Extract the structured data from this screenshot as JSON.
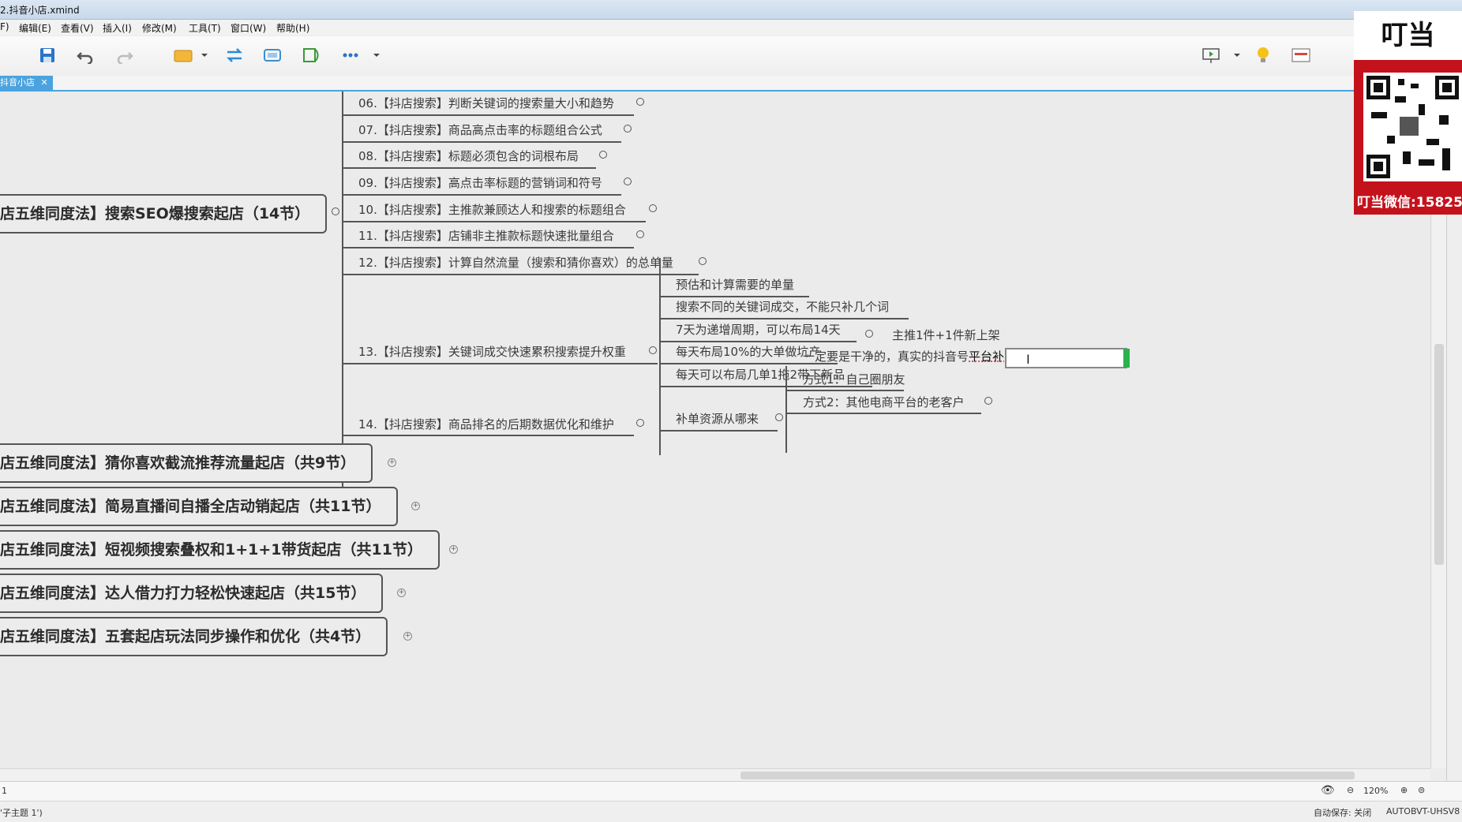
{
  "window": {
    "title": "2.抖音小店.xmind"
  },
  "menu": [
    "F)",
    "编辑(E)",
    "查看(V)",
    "插入(I)",
    "修改(M)",
    "工具(T)",
    "窗口(W)",
    "帮助(H)"
  ],
  "tab": {
    "label": "抖音小店",
    "close": "✕"
  },
  "topics": {
    "t06": "06.【抖店搜索】判断关键词的搜索量大小和趋势",
    "t07": "07.【抖店搜索】商品高点击率的标题组合公式",
    "t08": "08.【抖店搜索】标题必须包含的词根布局",
    "t09": "09.【抖店搜索】高点击率标题的营销词和符号",
    "t10": "10.【抖店搜索】主推款兼顾达人和搜索的标题组合",
    "t11": "11.【抖店搜索】店铺非主推款标题快速批量组合",
    "t12": "12.【抖店搜索】计算自然流量（搜索和猜你喜欢）的总单量",
    "t13": "13.【抖店搜索】关键词成交快速累积搜索提升权重",
    "t14": "14.【抖店搜索】商品排名的后期数据优化和维护"
  },
  "sub13": {
    "a": "预估和计算需要的单量",
    "b": "搜索不同的关键词成交，不能只补几个词",
    "c": "7天为递增周期，可以布局14天",
    "d": "每天布局10%的大单做坑产",
    "e": "每天可以布局几单1拖2带下新品",
    "e_child": "主推1件+1件新上架",
    "f": "补单资源从哪来",
    "f1": "一定要是干净的，真实的抖音号",
    "f1_edit": "平台补",
    "f2": "方式1：自己圈朋友",
    "f3": "方式2：其他电商平台的老客户"
  },
  "main_topics": {
    "m1": "店五维同度法】搜索SEO爆搜索起店（14节）",
    "m2": "店五维同度法】猜你喜欢截流推荐流量起店（共9节）",
    "m3": "店五维同度法】简易直播间自播全店动销起店（共11节）",
    "m4": "店五维同度法】短视频搜索叠权和1+1+1带货起店（共11节）",
    "m5": "店五维同度法】达人借力打力轻松快速起店（共15节）",
    "m6": "店五维同度法】五套起店玩法同步操作和优化（共4节）"
  },
  "status": {
    "left_num": "1",
    "zoom": "120%",
    "bottom_left": "'子主题 1')",
    "autosave": "自动保存: 关闭",
    "user": "AUTOBVT-UHSV8"
  },
  "overlay": {
    "logo": "叮当",
    "wechat": "叮当微信:15825"
  },
  "colors": {
    "tab_accent": "#4aa3df",
    "edit_cursor": "#2bb24c",
    "overlay_red": "#c4121c"
  }
}
